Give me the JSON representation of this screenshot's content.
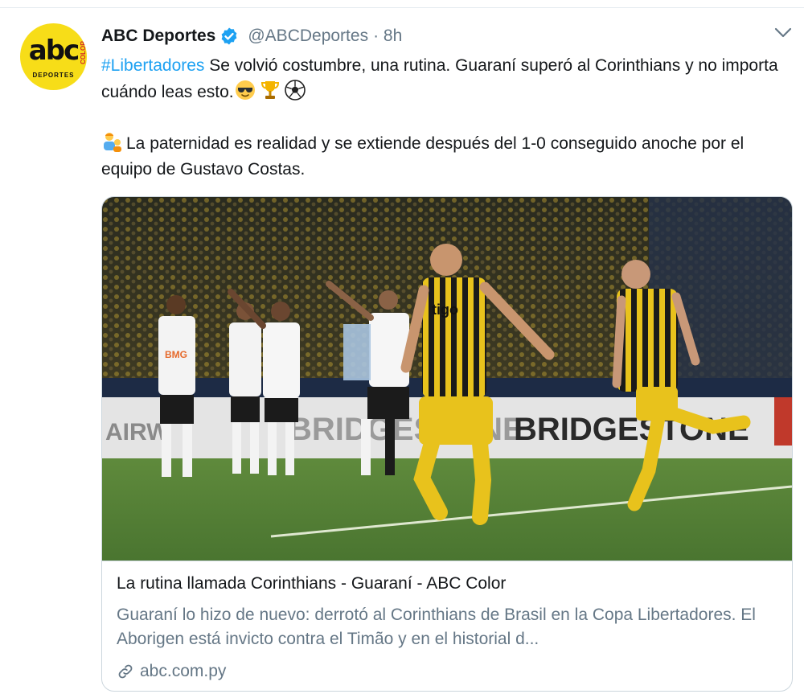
{
  "tweet": {
    "author_name": "ABC Deportes",
    "handle": "@ABCDeportes",
    "time": "· 8h",
    "avatar": {
      "logo_main": "abc",
      "logo_tag": "COLOR",
      "logo_sub": "DEPORTES"
    },
    "hashtag": "#Libertadores",
    "line1_text": " Se volvió costumbre, una rutina. Guaraní superó al Corinthians y no importa cuándo leas esto.",
    "line2_text": "La paternidad es realidad y se extiende después del 1-0 conseguido anoche por el equipo de Gustavo Costas.",
    "icons": [
      "verified-badge-icon",
      "chevron-down-icon",
      "sunglasses-emoji",
      "trophy-emoji",
      "soccer-ball-emoji",
      "family-emoji"
    ]
  },
  "card": {
    "title": "La rutina llamada Corinthians - Guaraní - ABC Color",
    "description": "Guaraní lo hizo de nuevo: derrotó al Corinthians de Brasil en la Copa Libertadores. El Aborigen está invicto contra el Timão y en el historial d...",
    "domain": "abc.com.py",
    "link_icon": "link-icon",
    "photo_texts": {
      "sponsor_home": "BMG",
      "sponsor_away": "tigo",
      "board_left": "AIRW",
      "board_mid": "BRIDGESTONE",
      "board_right": "BRIDGESTONE"
    }
  },
  "colors": {
    "link_blue": "#1da1f2",
    "secondary_text": "#657786",
    "border": "#ccd6dd",
    "logo_yellow": "#f7dd18"
  }
}
